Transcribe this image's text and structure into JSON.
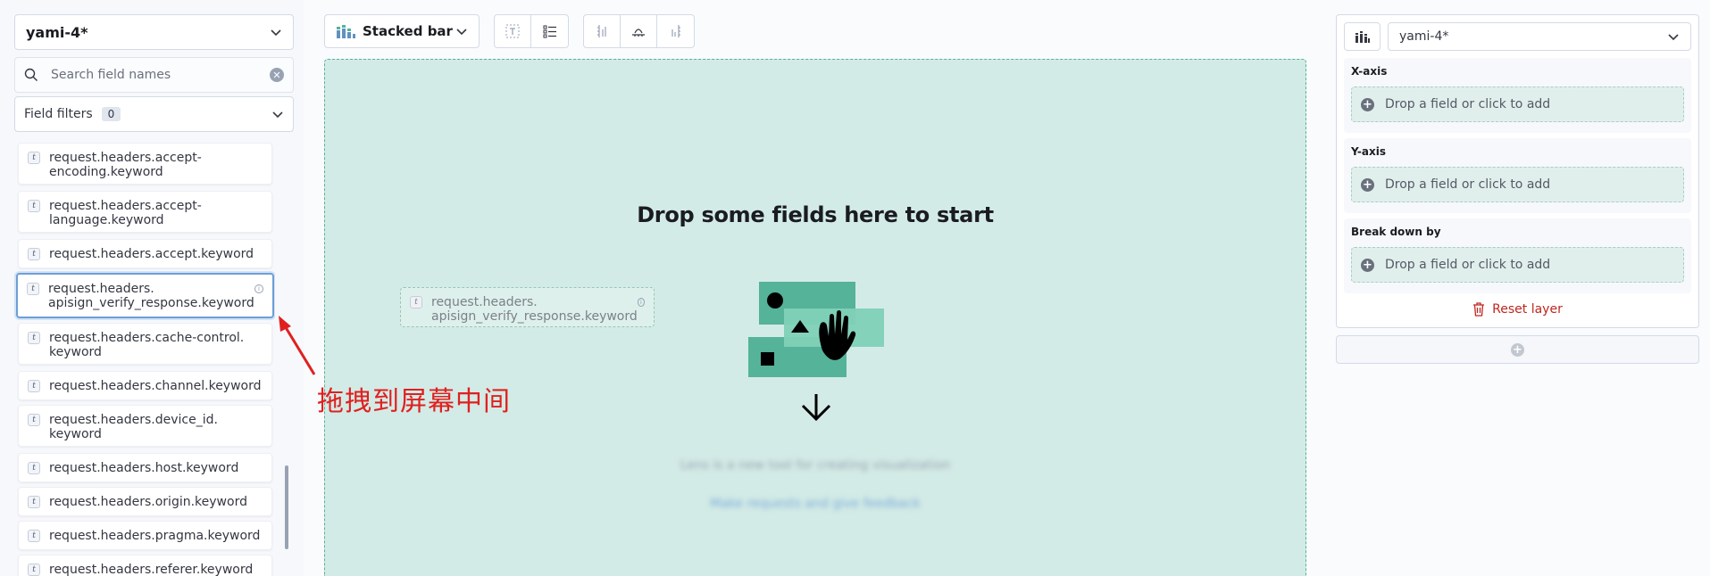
{
  "sidebar": {
    "data_view": "yami-4*",
    "search_placeholder": "Search field names",
    "filters_label": "Field filters",
    "filters_count": "0",
    "fields": [
      {
        "type": "t",
        "name": "request.headers.accept-\nencoding.keyword"
      },
      {
        "type": "t",
        "name": "request.headers.accept-\nlanguage.keyword"
      },
      {
        "type": "t",
        "name": "request.headers.accept.keyword"
      },
      {
        "type": "t",
        "name": "request.headers.\napisign_verify_response.keyword",
        "selected": true
      },
      {
        "type": "t",
        "name": "request.headers.cache-control.\nkeyword"
      },
      {
        "type": "t",
        "name": "request.headers.channel.keyword"
      },
      {
        "type": "t",
        "name": "request.headers.device_id.\nkeyword"
      },
      {
        "type": "t",
        "name": "request.headers.host.keyword"
      },
      {
        "type": "t",
        "name": "request.headers.origin.keyword"
      },
      {
        "type": "t",
        "name": "request.headers.pragma.keyword"
      },
      {
        "type": "t",
        "name": "request.headers.referer.keyword"
      }
    ]
  },
  "toolbar": {
    "chart_type": "Stacked bar"
  },
  "workspace": {
    "title": "Drop some fields here to start",
    "subtitle": "Lens is a new tool for creating visualization",
    "link": "Make requests and give feedback",
    "drag_ghost": {
      "type": "t",
      "name": "request.headers.\napisign_verify_response.keyword"
    }
  },
  "annotation": {
    "text": "拖拽到屏幕中间",
    "color": "#e02020"
  },
  "config_panel": {
    "layer_data_view": "yami-4*",
    "x_axis_label": "X-axis",
    "y_axis_label": "Y-axis",
    "breakdown_label": "Break down by",
    "drop_hint": "Drop a field or click to add",
    "reset_label": "Reset layer"
  },
  "colors": {
    "accent": "#54b399",
    "danger": "#bd271e",
    "workspace_bg": "#d3ebe6"
  }
}
